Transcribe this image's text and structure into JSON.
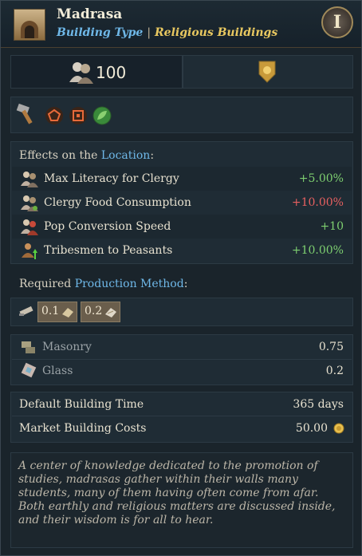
{
  "header": {
    "title": "Madrasa",
    "type_label": "Building Type",
    "separator": "|",
    "category": "Religious Buildings",
    "info_letter": "I"
  },
  "summary": {
    "pop_count": "100"
  },
  "effects": {
    "heading_prefix": "Effects on the",
    "heading_link": "Location",
    "heading_suffix": ":",
    "rows": [
      {
        "label": "Max Literacy for Clergy",
        "value": "+5.00%"
      },
      {
        "label": "Clergy Food Consumption",
        "value": "+10.00%"
      },
      {
        "label": "Pop Conversion Speed",
        "value": "+10"
      },
      {
        "label": "Tribesmen to Peasants",
        "value": "+10.00%"
      }
    ]
  },
  "production": {
    "heading_prefix": "Required",
    "heading_link": "Production Method",
    "heading_suffix": ":",
    "inputs": [
      "0.1",
      "0.2"
    ]
  },
  "goods": [
    {
      "name": "Masonry",
      "value": "0.75"
    },
    {
      "name": "Glass",
      "value": "0.2"
    }
  ],
  "costs": [
    {
      "label": "Default Building Time",
      "value": "365 days"
    },
    {
      "label": "Market Building Costs",
      "value": "50.00"
    }
  ],
  "description": "A center of knowledge dedicated to the promotion of studies, madrasas gather within their walls many students, many of them having often come from afar. Both earthly and religious matters are discussed inside, and their wisdom is for all to hear.",
  "colors": {
    "positive": "#7ed070",
    "negative": "#e86060",
    "link": "#6fb8e8",
    "category": "#e8c860"
  },
  "icons": [
    "building-icon",
    "info-icon",
    "pops-icon",
    "emblem-icon",
    "hammer-icon",
    "pentagon-icon",
    "square-icon",
    "leaf-icon",
    "clergy-icon",
    "tribesmen-icon",
    "scroll-icon",
    "masonry-icon",
    "glass-icon",
    "coin-icon"
  ]
}
